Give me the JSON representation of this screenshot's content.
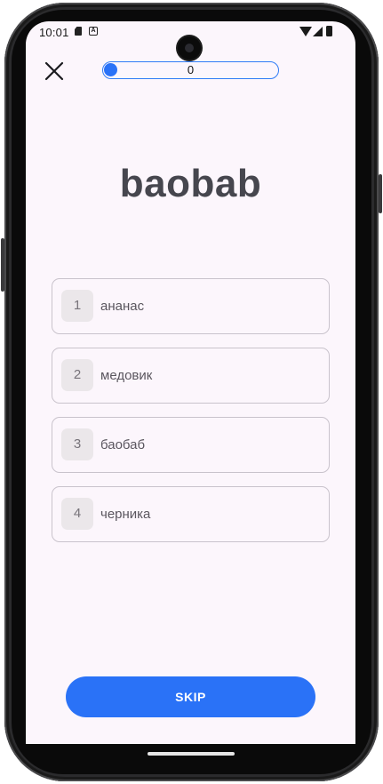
{
  "status_bar": {
    "time": "10:01",
    "icons": [
      "sim-icon",
      "app-notification-icon",
      "wifi-icon",
      "signal-icon",
      "battery-icon"
    ]
  },
  "header": {
    "close_icon": "close-icon",
    "progress_value": 0,
    "progress_text": "0",
    "accent_color": "#2a72f7"
  },
  "quiz": {
    "word": "baobab",
    "options": [
      {
        "number": "1",
        "label": "ананас"
      },
      {
        "number": "2",
        "label": "медовик"
      },
      {
        "number": "3",
        "label": "баобаб"
      },
      {
        "number": "4",
        "label": "черника"
      }
    ]
  },
  "footer": {
    "skip_label": "SKIP"
  }
}
